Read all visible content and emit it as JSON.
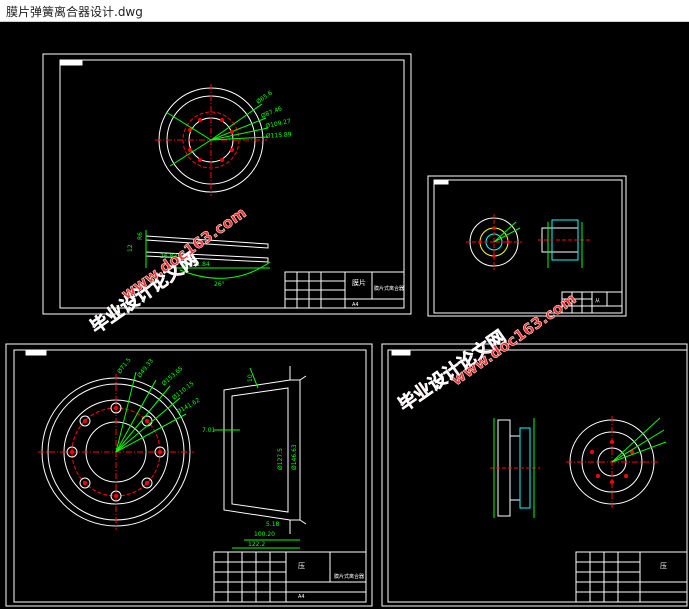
{
  "window": {
    "title": "膜片弹簧离合器设计.dwg"
  },
  "colors": {
    "frame": "#ffffff",
    "green": "#00ff00",
    "red": "#ff0000",
    "yellow": "#ffff00",
    "cyan": "#00ffff",
    "watermark": "#ff3030"
  },
  "watermark": {
    "cn": "毕业设计论文网",
    "url": "www.doc163.com"
  },
  "drawings": [
    {
      "id": "sheet-1",
      "title_block": {
        "name": "膜片",
        "part": "膜片式离合器",
        "scale": "A4"
      },
      "dims": [
        "Ø65.6",
        "Ø87.46",
        "Ø109.27",
        "Ø115.89",
        "12",
        "R6",
        "26.83",
        "Ø131.84",
        "26°"
      ]
    },
    {
      "id": "sheet-2",
      "title_block": {
        "name": "从",
        "part": "",
        "scale": ""
      },
      "dims": []
    },
    {
      "id": "sheet-3",
      "title_block": {
        "name": "压",
        "part": "膜片式离合器",
        "scale": "A4"
      },
      "dims": [
        "Ø71.5",
        "Ø49.33",
        "Ø153.65",
        "Ø110.15",
        "Ø141.62",
        "10",
        "7.01",
        "Ø127.5",
        "Ø146.63",
        "5.18",
        "100.20",
        "122.2"
      ]
    },
    {
      "id": "sheet-4",
      "title_block": {
        "name": "压",
        "part": "",
        "scale": ""
      },
      "dims": []
    }
  ]
}
